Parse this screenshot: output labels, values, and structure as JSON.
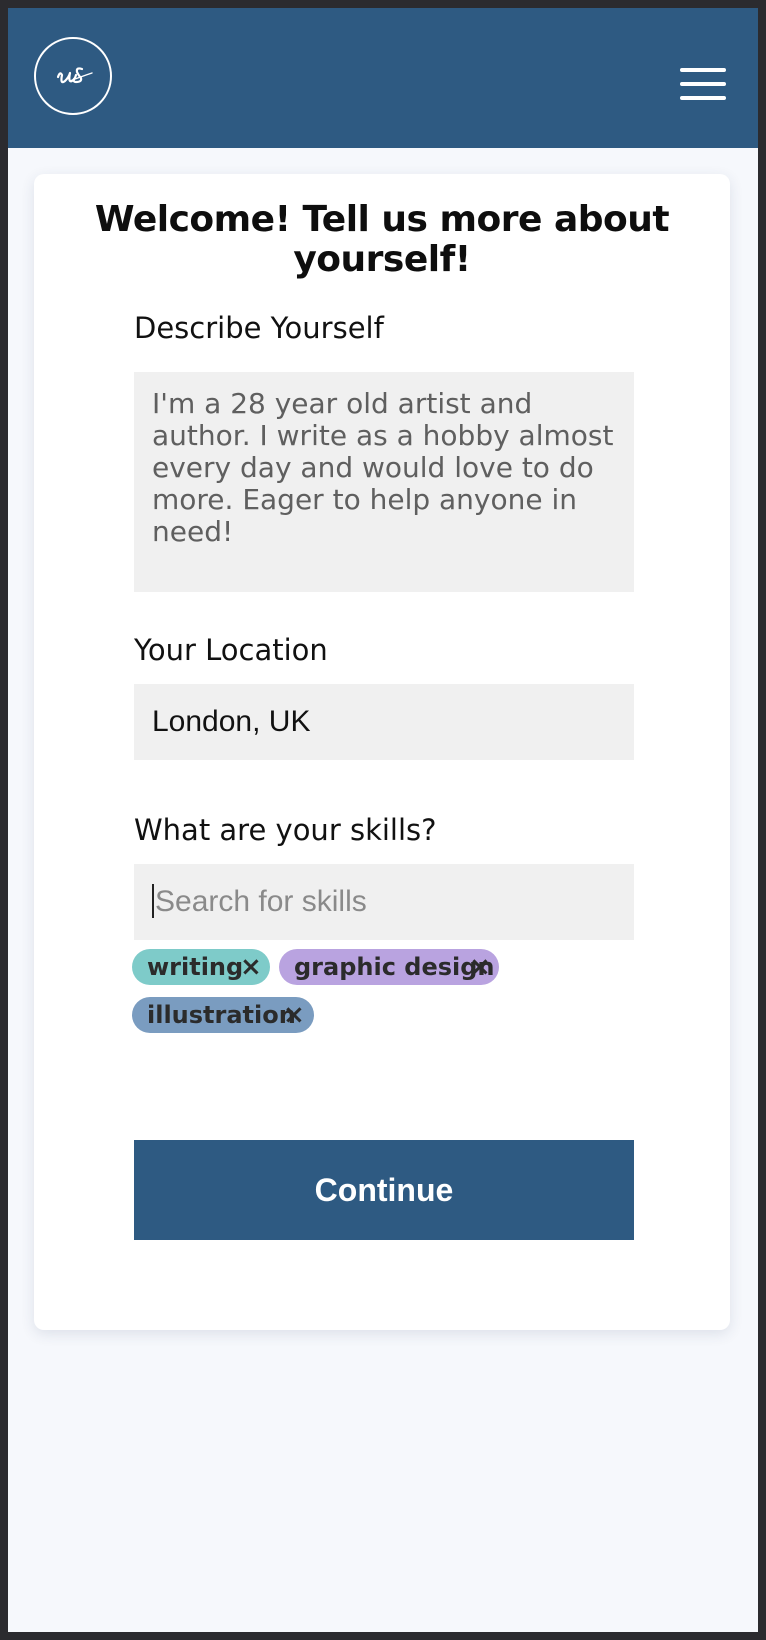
{
  "header": {
    "logo_icon": "us-signature-logo",
    "menu_icon": "hamburger-menu-icon",
    "background": "#2e5a82"
  },
  "form": {
    "title": "Welcome! Tell us more about yourself!",
    "describe": {
      "label": "Describe Yourself",
      "value": "I'm a 28 year old artist and author. I write as a hobby almost every day and would love to do more. Eager to help anyone in need!"
    },
    "location": {
      "label": "Your Location",
      "value": "London, UK"
    },
    "skills": {
      "label": "What are your skills?",
      "placeholder": "Search for skills",
      "selected": [
        {
          "label": "writing",
          "remove": "×",
          "color": "#7ecbc9"
        },
        {
          "label": "graphic design",
          "remove": "×",
          "color": "#b9a3e0"
        },
        {
          "label": "illustration",
          "remove": "×",
          "color": "#7a9cc0"
        }
      ]
    },
    "continue_label": "Continue"
  },
  "colors": {
    "primary": "#2e5a82",
    "page_background": "#f6f8fc",
    "field_background": "#f0f0f0"
  }
}
